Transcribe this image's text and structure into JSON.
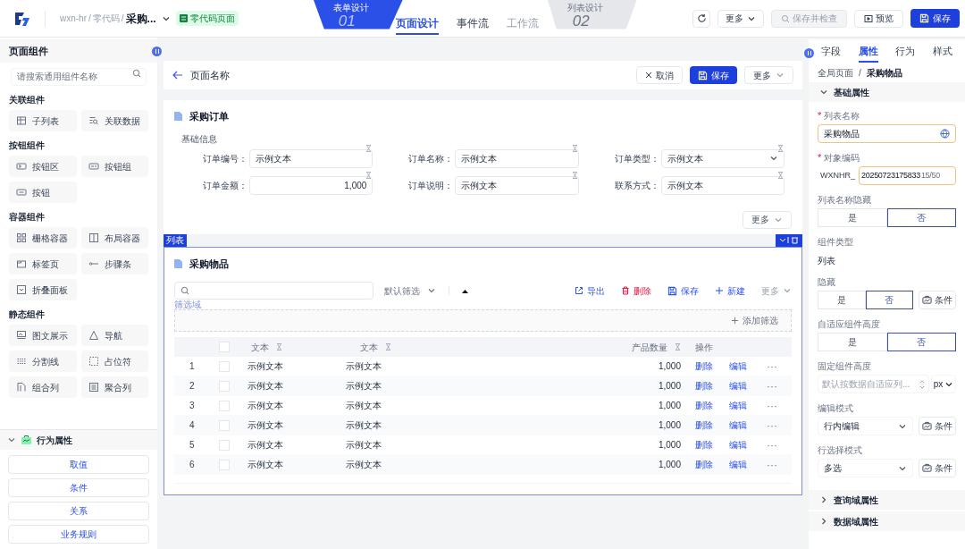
{
  "topbar": {
    "breadcrumb": [
      "wxn-hr",
      "零代码",
      "采购..."
    ],
    "separator": "/",
    "tag": "零代码页面",
    "steps": [
      {
        "label": "表单设计",
        "number": "01",
        "selected": true
      },
      {
        "label": "列表设计",
        "number": "02",
        "selected": false
      }
    ],
    "tabs": [
      {
        "label": "页面设计",
        "selected": true,
        "disabled": false
      },
      {
        "label": "事件流",
        "selected": false,
        "disabled": false
      },
      {
        "label": "工作流",
        "selected": false,
        "disabled": true
      }
    ],
    "actions": [
      {
        "kind": "refresh"
      },
      {
        "kind": "more",
        "label": "更多"
      },
      {
        "kind": "check",
        "label": "保存并检查",
        "disabled": true
      },
      {
        "kind": "preview",
        "label": "预览"
      },
      {
        "kind": "save",
        "label": "保存"
      }
    ]
  },
  "left_panel": {
    "title": "页面组件",
    "search_placeholder": "请搜索通用组件名称",
    "groups": [
      {
        "title": "关联组件",
        "items": [
          {
            "label": "子列表",
            "kind": "table"
          },
          {
            "label": "关联数据",
            "kind": "link"
          }
        ]
      },
      {
        "title": "按钮组件",
        "items": [
          {
            "label": "按钮区",
            "kind": "btnarea"
          },
          {
            "label": "按钮组",
            "kind": "btngroup"
          },
          {
            "label": "按钮",
            "kind": "button"
          }
        ]
      },
      {
        "title": "容器组件",
        "items": [
          {
            "label": "栅格容器",
            "kind": "grid"
          },
          {
            "label": "布局容器",
            "kind": "layout"
          },
          {
            "label": "标签页",
            "kind": "tabs"
          },
          {
            "label": "步骤条",
            "kind": "steps"
          },
          {
            "label": "折叠面板",
            "kind": "collapse"
          }
        ]
      },
      {
        "title": "静态组件",
        "items": [
          {
            "label": "图文展示",
            "kind": "image"
          },
          {
            "label": "导航",
            "kind": "nav"
          },
          {
            "label": "分割线",
            "kind": "divider"
          },
          {
            "label": "占位符",
            "kind": "placeholder"
          },
          {
            "label": "组合列",
            "kind": "combo"
          },
          {
            "label": "聚合列",
            "kind": "aggregate"
          }
        ]
      }
    ],
    "behavior": {
      "title": "行为属性",
      "expanded": true,
      "buttons": [
        "取值",
        "条件",
        "关系",
        "业务规则"
      ]
    }
  },
  "page": {
    "title": "页面名称",
    "buttons": [
      {
        "kind": "cancel",
        "label": "取消"
      },
      {
        "kind": "save",
        "label": "保存"
      },
      {
        "kind": "more",
        "label": "更多"
      }
    ],
    "form": {
      "title": "采购订单",
      "section": "基础信息",
      "fields": [
        {
          "label": "订单编号：",
          "value": "示例文本",
          "kind": "text"
        },
        {
          "label": "订单名称：",
          "value": "示例文本",
          "kind": "text"
        },
        {
          "label": "订单类型：",
          "value": "示例文本",
          "kind": "select"
        },
        {
          "label": "订单金额：",
          "value": "1,000",
          "kind": "number"
        },
        {
          "label": "订单说明：",
          "value": "示例文本",
          "kind": "text"
        },
        {
          "label": "联系方式：",
          "value": "示例文本",
          "kind": "text"
        }
      ],
      "more": "更多"
    },
    "list": {
      "tag": "列表",
      "title": "采购物品",
      "filter": "默认筛选",
      "filter_area": "筛选域",
      "add_filter": "添加筛选",
      "toolbar": [
        {
          "kind": "export",
          "label": "导出"
        },
        {
          "kind": "delete",
          "label": "删除"
        },
        {
          "kind": "save",
          "label": "保存"
        },
        {
          "kind": "new",
          "label": "新建"
        },
        {
          "kind": "more",
          "label": "更多"
        }
      ],
      "columns": [
        "文本",
        "文本",
        "产品数量",
        "操作"
      ],
      "select_all_checked": false,
      "rows": [
        {
          "index": "1",
          "checked": false,
          "col_1": "示例文本",
          "col_2": "示例文本",
          "qty": "1,000",
          "actions": [
            "删除",
            "编辑"
          ],
          "more": "···"
        },
        {
          "index": "2",
          "checked": false,
          "col_1": "示例文本",
          "col_2": "示例文本",
          "qty": "1,000",
          "actions": [
            "删除",
            "编辑"
          ],
          "more": "···"
        },
        {
          "index": "3",
          "checked": false,
          "col_1": "示例文本",
          "col_2": "示例文本",
          "qty": "1,000",
          "actions": [
            "删除",
            "编辑"
          ],
          "more": "···"
        },
        {
          "index": "4",
          "checked": false,
          "col_1": "示例文本",
          "col_2": "示例文本",
          "qty": "1,000",
          "actions": [
            "删除",
            "编辑"
          ],
          "more": "···"
        },
        {
          "index": "5",
          "checked": false,
          "col_1": "示例文本",
          "col_2": "示例文本",
          "qty": "1,000",
          "actions": [
            "删除",
            "编辑"
          ],
          "more": "···"
        },
        {
          "index": "6",
          "checked": false,
          "col_1": "示例文本",
          "col_2": "示例文本",
          "qty": "1,000",
          "actions": [
            "删除",
            "编辑"
          ],
          "more": "···"
        }
      ]
    }
  },
  "right_panel": {
    "tabs": [
      {
        "label": "字段",
        "selected": false
      },
      {
        "label": "属性",
        "selected": true
      },
      {
        "label": "行为",
        "selected": false
      },
      {
        "label": "样式",
        "selected": false
      }
    ],
    "breadcrumb": [
      "全局页面",
      "采购物品"
    ],
    "separator": "/",
    "required_mark": "*",
    "section": "基础属性",
    "props": [
      {
        "kind": "input",
        "label": "列表名称",
        "required": true,
        "value": "采购物品"
      },
      {
        "kind": "code",
        "label": "对象编码",
        "required": true,
        "prefix": "WXNHR_",
        "value": "20250723175833",
        "counter": "15/50"
      },
      {
        "kind": "toggle",
        "label": "列表名称隐藏",
        "options": [
          {
            "label": "是",
            "selected": false
          },
          {
            "label": "否",
            "selected": true
          }
        ]
      },
      {
        "kind": "text",
        "label": "组件类型",
        "value": "列表"
      },
      {
        "kind": "toggle",
        "label": "隐藏",
        "options": [
          {
            "label": "是",
            "selected": false
          },
          {
            "label": "否",
            "selected": true
          }
        ],
        "condition": "条件"
      },
      {
        "kind": "toggle",
        "label": "自适应组件高度",
        "options": [
          {
            "label": "是",
            "selected": false
          },
          {
            "label": "否",
            "selected": true
          }
        ]
      },
      {
        "kind": "number",
        "label": "固定组件高度",
        "placeholder": "默认按数据自适应列...",
        "unit": "px"
      },
      {
        "kind": "select",
        "label": "编辑模式",
        "value": "行内编辑",
        "condition": "条件"
      },
      {
        "kind": "select",
        "label": "行选择模式",
        "value": "多选",
        "condition": "条件"
      }
    ],
    "collapsed": [
      "查询域属性",
      "数据域属性"
    ]
  }
}
